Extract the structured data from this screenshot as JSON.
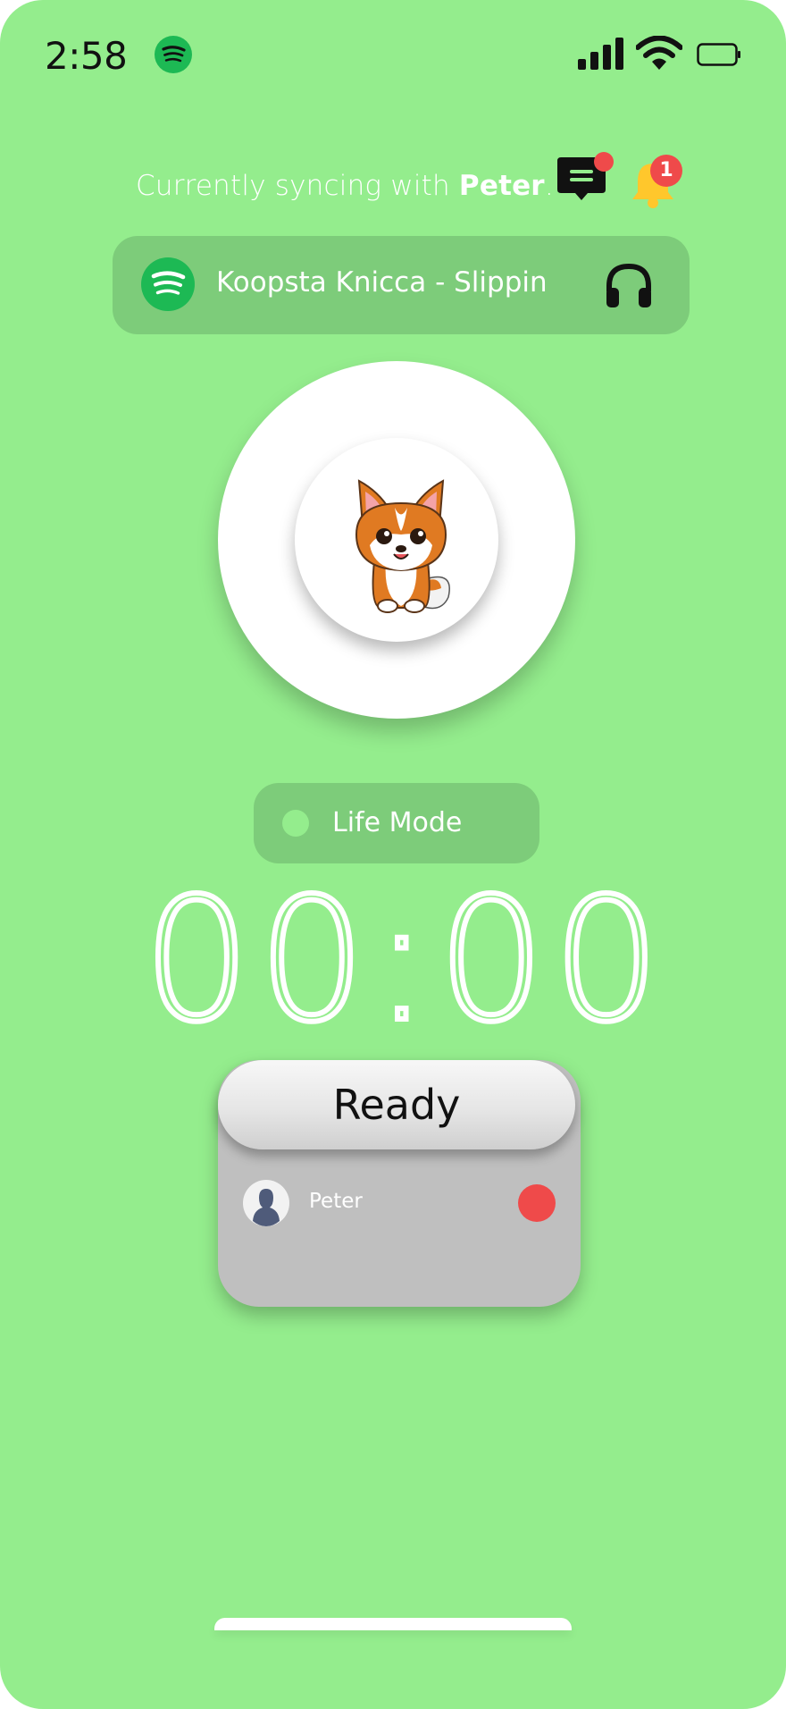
{
  "status_bar": {
    "time": "2:58",
    "icons": [
      "spotify-icon",
      "signal-icon",
      "wifi-icon",
      "battery-icon"
    ]
  },
  "header": {
    "sync_prefix": "Currently syncing with ",
    "sync_name": "Peter",
    "sync_suffix": ".",
    "notification_count": "1"
  },
  "now_playing": {
    "track": "Koopsta Knicca - Slippin",
    "service_icon": "spotify-icon",
    "action_icon": "headphones-icon"
  },
  "avatar": {
    "icon": "fox-avatar-icon"
  },
  "mode": {
    "label": "Life Mode"
  },
  "timer": {
    "value": "00:00"
  },
  "session": {
    "ready_label": "Ready",
    "participants": [
      {
        "name": "Peter",
        "status": "not-ready",
        "status_color": "#ef4a4a"
      }
    ]
  },
  "colors": {
    "background": "#94ed8d",
    "panel": "#7dcc7a",
    "spotify": "#1db954",
    "alert": "#ef4a4a",
    "bell": "#ffc72c"
  }
}
